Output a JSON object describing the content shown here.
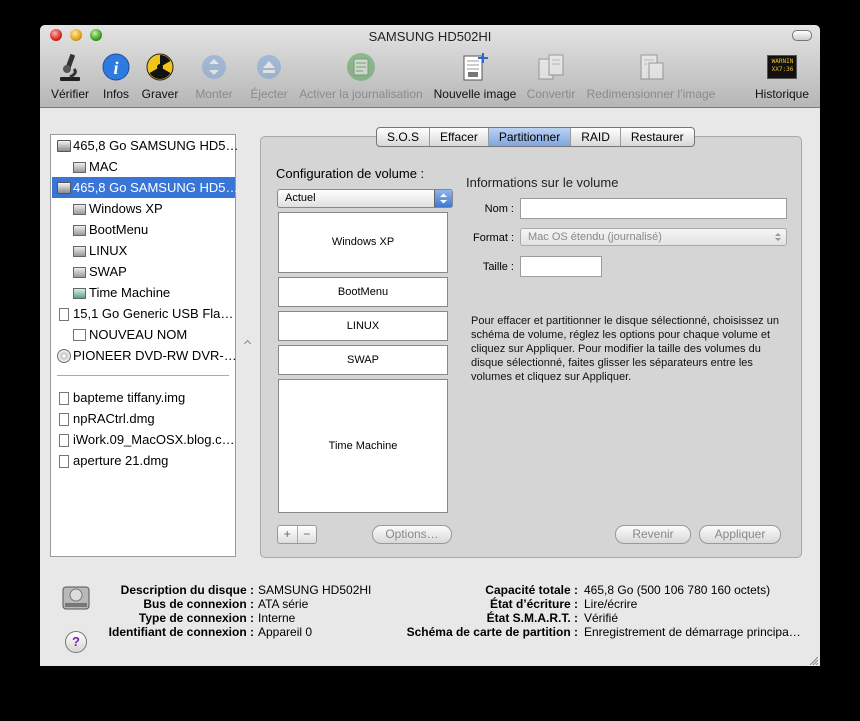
{
  "window": {
    "title": "SAMSUNG HD502HI"
  },
  "toolbar": {
    "verify": "Vérifier",
    "info": "Infos",
    "burn": "Graver",
    "mount": "Monter",
    "eject": "Éjecter",
    "journal": "Activer la journalisation",
    "new_image": "Nouvelle image",
    "convert": "Convertir",
    "resize": "Redimensionner l’image",
    "log": "Historique",
    "log_icon_text": "WARNIN\nXX7:36"
  },
  "sidebar": {
    "items": [
      {
        "label": "465,8 Go SAMSUNG HD5…"
      },
      {
        "label": "MAC"
      },
      {
        "label": "465,8 Go SAMSUNG HD5…"
      },
      {
        "label": "Windows XP"
      },
      {
        "label": "BootMenu"
      },
      {
        "label": "LINUX"
      },
      {
        "label": "SWAP"
      },
      {
        "label": "Time Machine"
      },
      {
        "label": "15,1 Go Generic USB Fla…"
      },
      {
        "label": "NOUVEAU NOM"
      },
      {
        "label": "PIONEER DVD-RW DVR-…"
      }
    ],
    "images": [
      {
        "label": "bapteme tiffany.img"
      },
      {
        "label": "npRACtrl.dmg"
      },
      {
        "label": "iWork.09_MacOSX.blog.c…"
      },
      {
        "label": "aperture 21.dmg"
      }
    ]
  },
  "tabs": [
    "S.O.S",
    "Effacer",
    "Partitionner",
    "RAID",
    "Restaurer"
  ],
  "partition": {
    "config_label": "Configuration de volume :",
    "scheme_value": "Actuel",
    "volumes": [
      {
        "name": "Windows XP"
      },
      {
        "name": "BootMenu"
      },
      {
        "name": "LINUX"
      },
      {
        "name": "SWAP"
      },
      {
        "name": "Time Machine"
      }
    ],
    "add": "+",
    "remove": "−",
    "options": "Options…",
    "info_title": "Informations sur le volume",
    "name_label": "Nom :",
    "name_value": "",
    "format_label": "Format :",
    "format_value": "Mac OS étendu (journalisé)",
    "size_label": "Taille :",
    "size_value": "",
    "help": "Pour effacer et partitionner le disque sélectionné, choisissez un schéma de volume, réglez les options pour chaque volume et cliquez sur Appliquer. Pour modifier la taille des volumes du disque sélectionné, faites glisser les séparateurs entre les volumes et cliquez sur Appliquer.",
    "revert": "Revenir",
    "apply": "Appliquer"
  },
  "footer": {
    "desc_label": "Description du disque :",
    "desc_value": "SAMSUNG HD502HI",
    "bus_label": "Bus de connexion :",
    "bus_value": "ATA série",
    "type_label": "Type de connexion :",
    "type_value": "Interne",
    "id_label": "Identifiant de connexion :",
    "id_value": "Appareil 0",
    "cap_label": "Capacité totale :",
    "cap_value": "465,8 Go (500 106 780 160 octets)",
    "write_label": "État d’écriture :",
    "write_value": "Lire/écrire",
    "smart_label": "État S.M.A.R.T. :",
    "smart_value": "Vérifié",
    "scheme_label": "Schéma de carte de partition :",
    "scheme_value": "Enregistrement de démarrage principa…",
    "help_icon": "?"
  }
}
